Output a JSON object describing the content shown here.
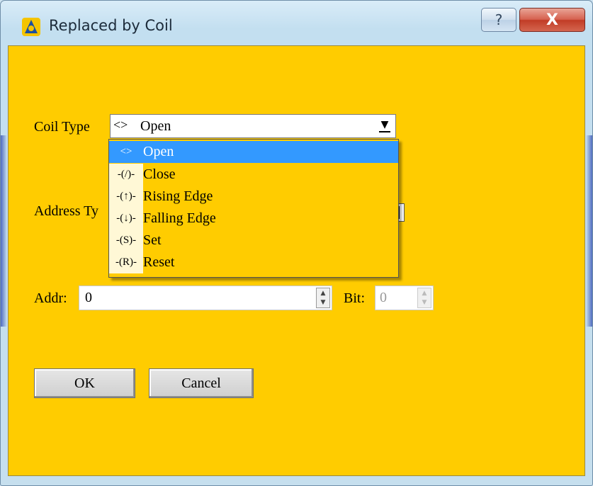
{
  "window": {
    "title": "Replaced by Coil",
    "help_label": "?",
    "close_label": "X",
    "client_color": "#ffcc00"
  },
  "form": {
    "coil_type_label": "Coil Type",
    "coil_type_icon": "<>",
    "coil_type_value": "Open",
    "address_type_label": "Address Ty",
    "addr_label": "Addr:",
    "addr_value": "0",
    "bit_label": "Bit:",
    "bit_value": "0"
  },
  "dropdown": {
    "selected_index": 0,
    "items": [
      {
        "icon": "<>",
        "label": "Open"
      },
      {
        "icon": "-(/)-",
        "label": "Close"
      },
      {
        "icon": "-(↑)-",
        "label": "Rising Edge"
      },
      {
        "icon": "-(↓)-",
        "label": "Falling Edge"
      },
      {
        "icon": "-(S)-",
        "label": "Set"
      },
      {
        "icon": "-(R)-",
        "label": "Reset"
      }
    ]
  },
  "buttons": {
    "ok": "OK",
    "cancel": "Cancel"
  },
  "icons": {
    "app": "app-logo-icon",
    "spin_up": "▲",
    "spin_down": "▼",
    "dropdown_arrow": "▼"
  }
}
